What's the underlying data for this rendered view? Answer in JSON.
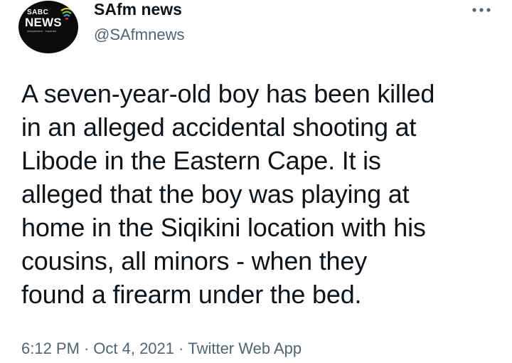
{
  "account": {
    "display_name": "SAfm news",
    "handle": "@SAfmnews",
    "avatar": {
      "brand_top": "SABC",
      "brand_main": "NEWS",
      "tagline": "independent · impartial",
      "background": "#0b0b0b"
    }
  },
  "menu": {
    "more_icon": "more-horizontal-icon"
  },
  "tweet": {
    "lines": [
      "A seven-year-old boy has been killed",
      "in an alleged accidental shooting at",
      "Libode in the Eastern Cape. It is",
      "alleged that the boy was playing at",
      "home in the Siqikini location with his",
      "cousins, all minors - when they",
      "found a firearm under the bed."
    ]
  },
  "meta": {
    "time": "6:12 PM",
    "separator": "·",
    "date": "Oct 4, 2021",
    "source": "Twitter Web App"
  },
  "colors": {
    "text_primary": "#0f1419",
    "text_secondary": "#536471",
    "background": "#ffffff"
  }
}
